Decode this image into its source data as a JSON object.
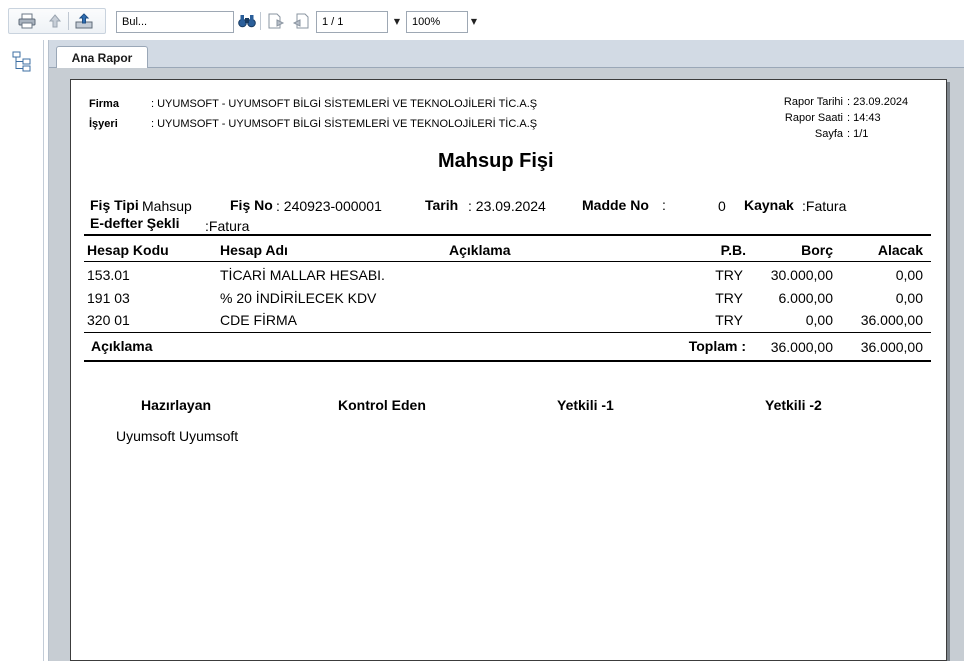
{
  "toolbar": {
    "search_value": "Bul...",
    "page_value": "1 / 1",
    "zoom_value": "100%"
  },
  "tabs": [
    {
      "label": "Ana Rapor"
    }
  ],
  "report": {
    "firma_label": "Firma",
    "firma_value": ": UYUMSOFT - UYUMSOFT BİLGİ SİSTEMLERİ VE TEKNOLOJİLERİ TİC.A.Ş",
    "isyeri_label": "İşyeri",
    "isyeri_value": ": UYUMSOFT - UYUMSOFT BİLGİ SİSTEMLERİ VE TEKNOLOJİLERİ TİC.A.Ş",
    "rapor_tarihi_label": "Rapor Tarihi",
    "rapor_tarihi_value": ": 23.09.2024",
    "rapor_saati_label": "Rapor Saati",
    "rapor_saati_value": ": 14:43",
    "sayfa_label": "Sayfa",
    "sayfa_value": ": 1/1",
    "title": "Mahsup Fişi",
    "fis_tipi_label": "Fiş Tipi",
    "fis_tipi_value": "Mahsup",
    "fis_no_label": "Fiş No",
    "fis_no_value": ": 240923-000001",
    "tarih_label": "Tarih",
    "tarih_value": ": 23.09.2024",
    "madde_no_label": "Madde No",
    "madde_no_colon": ":",
    "madde_no_value": "0",
    "kaynak_label": "Kaynak",
    "kaynak_value": ":Fatura",
    "edefter_label": "E-defter Şekli",
    "edefter_value": ":Fatura",
    "columns": {
      "hesap_kodu": "Hesap Kodu",
      "hesap_adi": "Hesap Adı",
      "aciklama": "Açıklama",
      "pb": "P.B.",
      "borc": "Borç",
      "alacak": "Alacak"
    },
    "rows": [
      {
        "kod": "153.01",
        "ad": "TİCARİ MALLAR HESABI.",
        "aciklama": "",
        "pb": "TRY",
        "borc": "30.000,00",
        "alacak": "0,00"
      },
      {
        "kod": "191 03",
        "ad": "% 20 İNDİRİLECEK KDV",
        "aciklama": "",
        "pb": "TRY",
        "borc": "6.000,00",
        "alacak": "0,00"
      },
      {
        "kod": "320 01",
        "ad": "CDE FİRMA",
        "aciklama": "",
        "pb": "TRY",
        "borc": "0,00",
        "alacak": "36.000,00"
      }
    ],
    "footer_aciklama": "Açıklama",
    "toplam_label": "Toplam :",
    "toplam_borc": "36.000,00",
    "toplam_alacak": "36.000,00",
    "hazirlayan_label": "Hazırlayan",
    "kontrol_label": "Kontrol Eden",
    "yetkili1_label": "Yetkili -1",
    "yetkili2_label": "Yetkili -2",
    "hazirlayan_value": "Uyumsoft Uyumsoft"
  },
  "colors": {
    "accent": "#2f6fb4",
    "paper_border": "#3c3c3c",
    "workspace": "#c7cdd3"
  }
}
